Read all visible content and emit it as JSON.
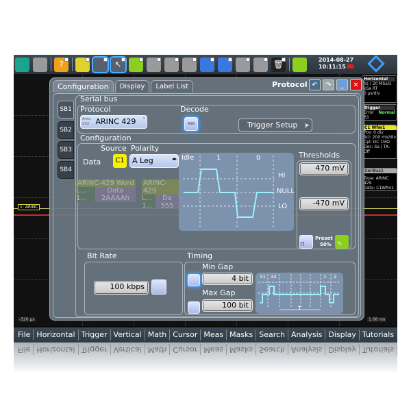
{
  "toolbar": {
    "buttons": [
      {
        "name": "undo",
        "icon": "undo-arrow-icon",
        "color": "#1aa48c"
      },
      {
        "name": "redo",
        "icon": "redo-arrow-icon",
        "color": "#9a9a9a"
      },
      {
        "name": "help",
        "icon": "help-icon",
        "color": "#f0a020",
        "glyph": "?"
      },
      {
        "name": "open",
        "icon": "folder-icon",
        "color": "#e0d030"
      },
      {
        "name": "grid-layout",
        "icon": "layout-icon",
        "color": "#556070"
      },
      {
        "name": "pointer",
        "icon": "pointer-icon",
        "color": "#556070",
        "glyph": "↖"
      },
      {
        "name": "zoom",
        "icon": "zoom-icon",
        "color": "#8ccf20"
      },
      {
        "name": "cursor-tool",
        "icon": "cursor-tool-icon",
        "color": "#9a9a9a"
      },
      {
        "name": "fft",
        "icon": "fft-icon",
        "color": "#9a9a9a"
      },
      {
        "name": "mask",
        "icon": "mask-icon",
        "color": "#9a9a9a"
      },
      {
        "name": "probe",
        "icon": "probe-icon",
        "color": "#3a78e0"
      },
      {
        "name": "power-probe",
        "icon": "power-probe-icon",
        "color": "#3a78e0"
      },
      {
        "name": "history",
        "icon": "history-icon",
        "color": "#9a9a9a"
      },
      {
        "name": "binoculars",
        "icon": "search-icon",
        "color": "#9a9a9a"
      },
      {
        "name": "delete",
        "icon": "trash-icon",
        "color": "#222",
        "glyph": "🗑"
      },
      {
        "name": "autoset",
        "icon": "autoset-icon",
        "color": "#8ccf20"
      }
    ],
    "date": "2014-08-27",
    "time": "10:11:15"
  },
  "waveform": {
    "channel_label": "1: ARINC",
    "left_time": "-320 µs",
    "right_time": "1.68 ms"
  },
  "side_panel": {
    "horizontal": {
      "title": "Horizontal",
      "line1": "ns / 20 MSa/s",
      "line2": "kSa  RT",
      "line3": "0 µs/div"
    },
    "trigger": {
      "title": "Trigger",
      "mode": "Normal",
      "line1": "Error B1"
    },
    "channel": {
      "title": "C1 Wfm1",
      "line1": "Pos: 0 div",
      "line2": "Scl: 200 mV/div",
      "line3": "Cpl: DC 1MΩ",
      "line4": "Dec: Sa | TA: Off"
    },
    "serial": {
      "title": "SerBus1",
      "line1": "Type: ARINC 429",
      "line2": "Data: C1Wfm1"
    }
  },
  "dialog": {
    "tabs": [
      "Configuration",
      "Display",
      "Label List"
    ],
    "title": "Protocol",
    "sb_tabs": [
      "SB1",
      "SB2",
      "SB3",
      "SB4"
    ],
    "serial_bus_label": "Serial bus",
    "protocol_label": "Protocol",
    "protocol_value": "ARINC 429",
    "protocol_icon_text": "Arinc XXX",
    "decode_label": "Decode",
    "decode_icon_text": "ASB",
    "trigger_setup_label": "Trigger Setup",
    "configuration_label": "Configuration",
    "source_label": "Source",
    "polarity_label": "Polarity",
    "data_label": "Data",
    "source_value": "C1",
    "polarity_value": "A Leg",
    "diagram": {
      "idle": "Idle",
      "one": "1",
      "zero": "0",
      "hi": "HI",
      "null": "NULL",
      "lo": "LO"
    },
    "thresholds_label": "Thresholds",
    "threshold_high": "470 mV",
    "threshold_low": "-470 mV",
    "preset_label": "Preset",
    "preset_value": "50%",
    "bitrate_label": "Bit Rate",
    "bitrate_value": "100 kbps",
    "timing_label": "Timing",
    "min_gap_label": "Min Gap",
    "min_gap_value": "4 bit",
    "max_gap_label": "Max Gap",
    "max_gap_value": "100 bit",
    "timing_diagram": {
      "a": "31",
      "b": "32",
      "c": "1",
      "d": "2",
      "t": "T"
    },
    "decode_word": {
      "title": "ARINC-429 Word",
      "label_col": "L...",
      "data_col": "Data",
      "label_val": "1...",
      "data_val": "2AAAAh"
    },
    "decode_word2": {
      "title": "ARINC-429",
      "label_col": "L...",
      "data_col": "Da",
      "label_val": "1...",
      "data_val": "555"
    }
  },
  "menubar": {
    "items": [
      "File",
      "Horizontal",
      "Trigger",
      "Vertical",
      "Math",
      "Cursor",
      "Meas",
      "Masks",
      "Search",
      "Analysis",
      "Display",
      "Tutorials"
    ]
  }
}
